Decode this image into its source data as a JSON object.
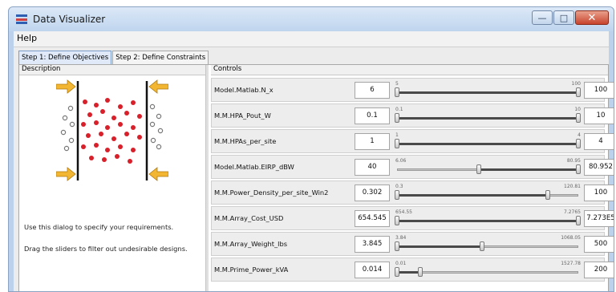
{
  "window": {
    "title": "Data Visualizer"
  },
  "menu": {
    "help": "Help"
  },
  "tabs": [
    {
      "label": "Step 1: Define Objectives",
      "active": true
    },
    {
      "label": "Step 2: Define Constraints",
      "active": false
    }
  ],
  "description": {
    "header": "Description",
    "line1": "Use this dialog to specify your requirements.",
    "line2": "Drag the sliders to filter out undesirable designs."
  },
  "controls": {
    "header": "Controls",
    "rows": [
      {
        "name": "Model.Matlab.N_x",
        "value": "6",
        "min": "5",
        "max": "100",
        "max_value": "100",
        "low": 0.0,
        "high": 1.0
      },
      {
        "name": "M.M.HPA_Pout_W",
        "value": "0.1",
        "min": "0.1",
        "max": "10",
        "max_value": "10",
        "low": 0.0,
        "high": 1.0
      },
      {
        "name": "M.M.HPAs_per_site",
        "value": "1",
        "min": "1",
        "max": "4",
        "max_value": "4",
        "low": 0.0,
        "high": 1.0
      },
      {
        "name": "Model.Matlab.EIRP_dBW",
        "value": "40",
        "min": "6.06",
        "max": "80.95",
        "max_value": "80.952",
        "low": 0.45,
        "high": 1.0
      },
      {
        "name": "M.M.Power_Density_per_site_Win2",
        "value": "0.302",
        "min": "0.3",
        "max": "120.81",
        "max_value": "100",
        "low": 0.0,
        "high": 0.83
      },
      {
        "name": "M.M.Array_Cost_USD",
        "value": "654.545",
        "min": "654.55",
        "max": "7.2765",
        "max_value": "7.273E5",
        "low": 0.0,
        "high": 1.0
      },
      {
        "name": "M.M.Array_Weight_lbs",
        "value": "3.845",
        "min": "3.84",
        "max": "1068.05",
        "max_value": "500",
        "low": 0.0,
        "high": 0.47
      },
      {
        "name": "M.M.Prime_Power_kVA",
        "value": "0.014",
        "min": "0.01",
        "max": "1527.78",
        "max_value": "200",
        "low": 0.0,
        "high": 0.13
      }
    ]
  },
  "colors": {
    "arrow": "#f2b632",
    "dot_red": "#d8202a",
    "dot_grey": "#888888"
  }
}
